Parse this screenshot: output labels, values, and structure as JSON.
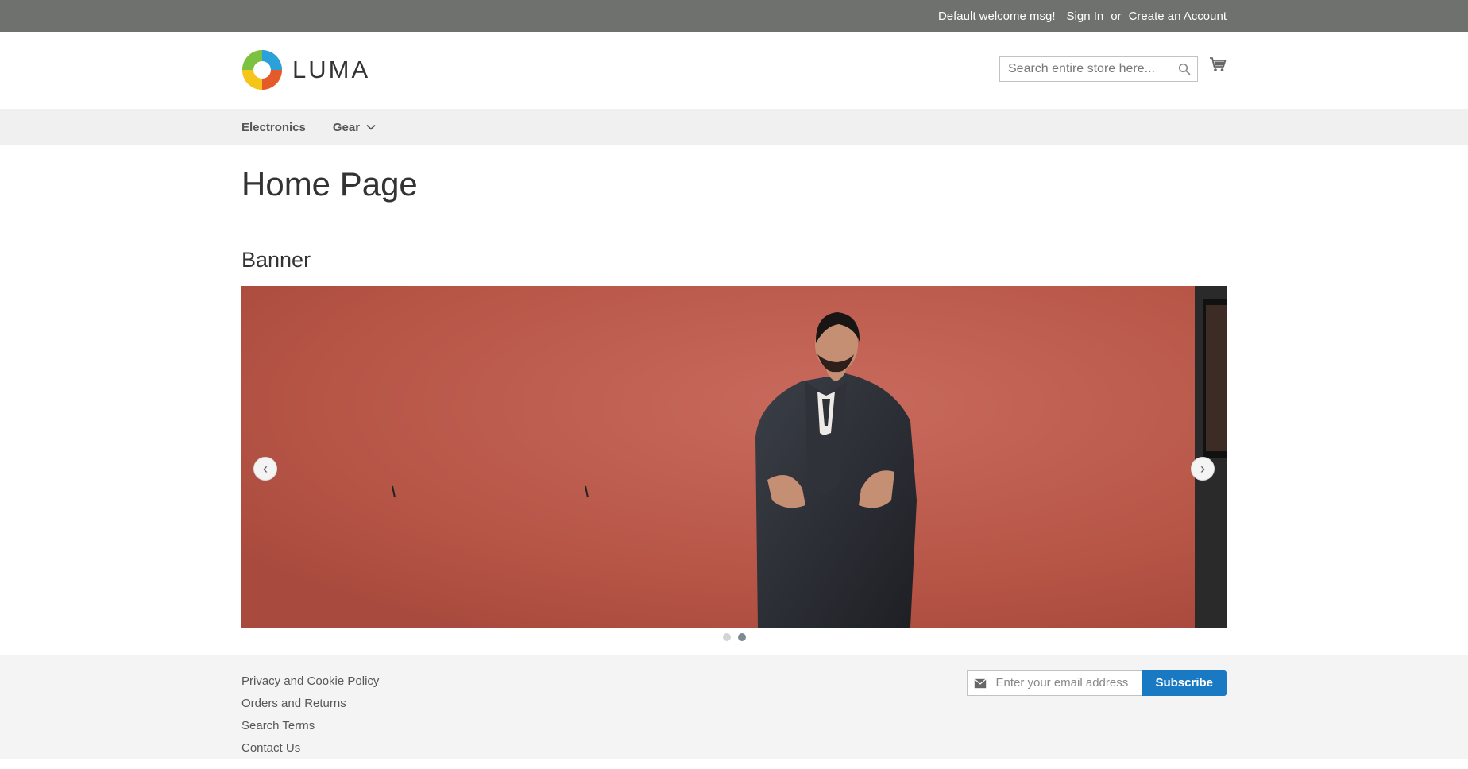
{
  "top_bar": {
    "welcome_msg": "Default welcome msg!",
    "sign_in": "Sign In",
    "or": "or",
    "create_account": "Create an Account"
  },
  "header": {
    "logo_text": "LUMA",
    "search_placeholder": "Search entire store here...",
    "search_icon": "magnifier-icon",
    "cart_icon": "shopping-cart-icon"
  },
  "nav": {
    "items": [
      {
        "label": "Electronics",
        "has_submenu": false
      },
      {
        "label": "Gear",
        "has_submenu": true
      }
    ]
  },
  "main": {
    "page_title": "Home Page",
    "section_title": "Banner",
    "carousel": {
      "prev_label": "‹",
      "next_label": "›",
      "slide_count": 2,
      "active_slide": 2
    }
  },
  "footer": {
    "links": [
      "Privacy and Cookie Policy",
      "Orders and Returns",
      "Search Terms",
      "Contact Us"
    ],
    "newsletter": {
      "placeholder": "Enter your email address",
      "button_label": "Subscribe"
    }
  },
  "colors": {
    "top_bar_bg": "#6e716e",
    "nav_bg": "#f0f0f0",
    "footer_bg": "#f4f4f4",
    "primary_button": "#1979c3",
    "banner_bg": "#b95749"
  }
}
